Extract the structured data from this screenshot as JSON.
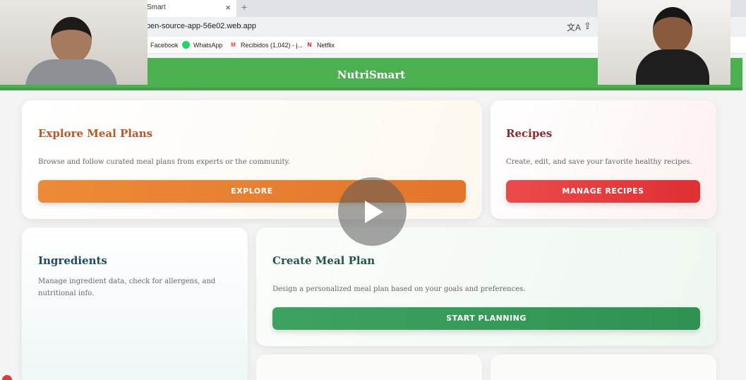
{
  "browser": {
    "tab_title": "Smart",
    "tab_close": "×",
    "new_tab": "+",
    "url": "pen-source-app-56e02.web.app",
    "bookmarks": [
      {
        "label": "Facebook",
        "icon": "facebook-icon",
        "color": "#1877f2",
        "glyph": ""
      },
      {
        "label": "WhatsApp",
        "icon": "whatsapp-icon",
        "color": "#25d366",
        "glyph": ""
      },
      {
        "label": "Recibidos (1,042) - j...",
        "icon": "gmail-icon",
        "color": "#ea4335",
        "glyph": "M"
      },
      {
        "label": "Netflix",
        "icon": "netflix-icon",
        "color": "#e50914",
        "glyph": "N"
      }
    ]
  },
  "app": {
    "title": "NutriSmart",
    "accent": "#4caf50"
  },
  "cards": {
    "explore": {
      "title": "Explore Meal Plans",
      "description": "Browse and follow curated meal plans from experts or the community.",
      "button": "EXPLORE",
      "color": "#e97f31"
    },
    "recipes": {
      "title": "Recipes",
      "description": "Create, edit, and save your favorite healthy recipes.",
      "button": "MANAGE RECIPES",
      "color": "#e43a3d"
    },
    "ingredients": {
      "title": "Ingredients",
      "description": "Manage ingredient data, check for allergens, and nutritional info."
    },
    "create": {
      "title": "Create Meal Plan",
      "description": "Design a personalized meal plan based on your goals and preferences.",
      "button": "START PLANNING",
      "color": "#3a9d5b"
    }
  },
  "video": {
    "play_icon": "play-icon"
  }
}
